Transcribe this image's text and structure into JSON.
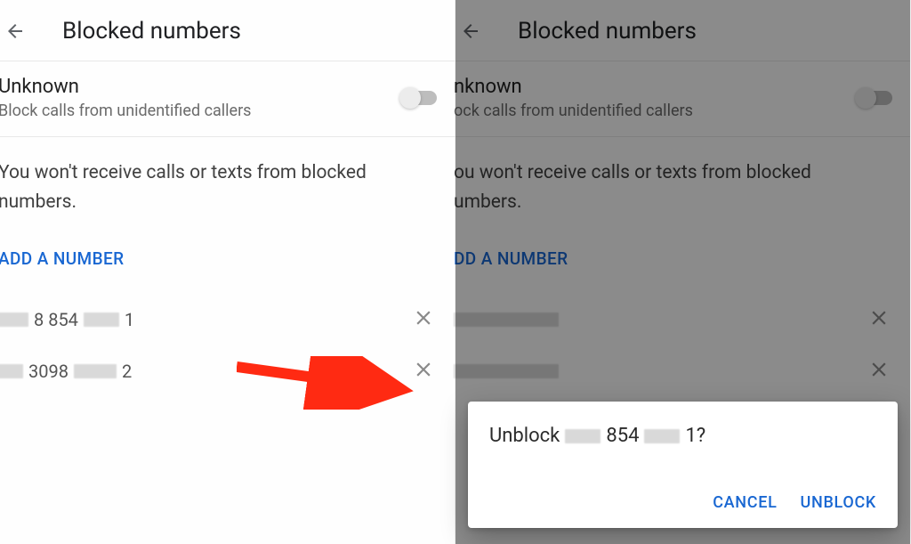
{
  "left": {
    "header_title": "Blocked numbers",
    "unknown_title": "Unknown",
    "unknown_subtitle": "Block calls from unidentified callers",
    "info_text": "You won't receive calls or texts from blocked numbers.",
    "add_number": "ADD A NUMBER",
    "numbers": [
      {
        "visible_digits_a": "8 854",
        "visible_digits_b": "1"
      },
      {
        "visible_digits_a": "3098",
        "visible_digits_b": "2"
      }
    ]
  },
  "right": {
    "header_title": "Blocked numbers",
    "unknown_title": "nknown",
    "unknown_subtitle": "ock calls from unidentified callers",
    "info_text_a": "ou won't receive calls or texts from blocked",
    "info_text_b": "umbers.",
    "add_number": "DD A NUMBER",
    "dialog": {
      "prefix": "Unblock",
      "mid": "854",
      "suffix": "1?",
      "cancel": "CANCEL",
      "unblock": "UNBLOCK"
    }
  }
}
